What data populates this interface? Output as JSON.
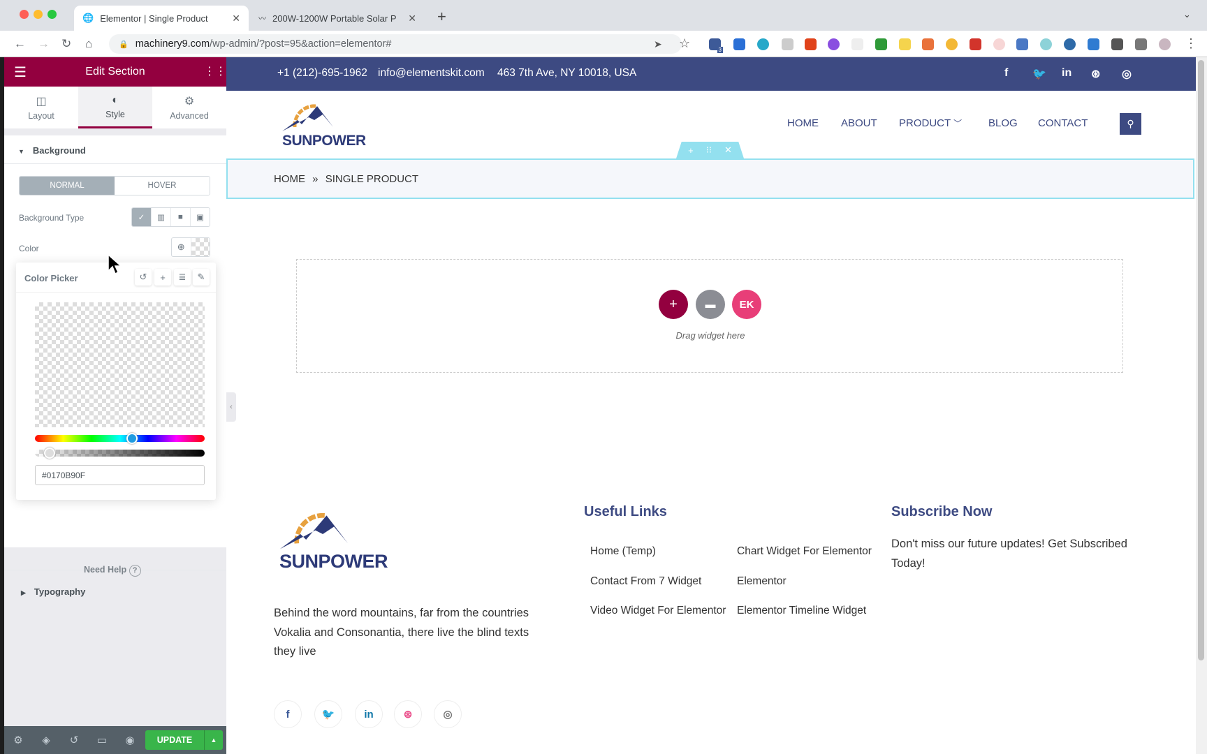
{
  "browser": {
    "tabs": [
      {
        "title": "Elementor | Single Product",
        "active": true
      },
      {
        "title": "200W-1200W Portable Solar P",
        "active": false
      }
    ],
    "url_host": "machinery9.com",
    "url_path": "/wp-admin/?post=95&action=elementor#",
    "extension_badge": "3"
  },
  "panel": {
    "title": "Edit Section",
    "tabs": [
      {
        "label": "Layout",
        "icon": "layout-icon"
      },
      {
        "label": "Style",
        "icon": "half-circle-icon",
        "active": true
      },
      {
        "label": "Advanced",
        "icon": "gear-icon"
      }
    ],
    "background_heading": "Background",
    "state_normal": "NORMAL",
    "state_hover": "HOVER",
    "background_type_label": "Background Type",
    "color_label": "Color",
    "color_picker": {
      "title": "Color Picker",
      "hex_value": "#0170B90F",
      "hue_fraction": 0.57,
      "alpha_fraction": 0.06
    },
    "typography_heading": "Typography",
    "need_help": "Need Help",
    "update_label": "UPDATE",
    "accent": "#93003f",
    "update_color": "#39b54a"
  },
  "site": {
    "topbar": {
      "phone": "+1 (212)-695-1962",
      "email": "info@elementskit.com",
      "address": "463 7th Ave, NY 10018, USA",
      "color": "#3d4a82"
    },
    "logo_text": "SUNPOWER",
    "nav": [
      "HOME",
      "ABOUT",
      "PRODUCT",
      "BLOG",
      "CONTACT"
    ],
    "breadcrumb": {
      "home": "HOME",
      "current": "SINGLE PRODUCT"
    },
    "drop_zone": "Drag widget here",
    "footer": {
      "about": "Behind the word mountains, far from the countries Vokalia and Consonantia, there live the blind texts they live",
      "useful_links_heading": "Useful Links",
      "links_col1": [
        "Home (Temp)",
        "Contact From 7 Widget",
        "Video Widget For Elementor"
      ],
      "links_col2": [
        "Chart Widget For Elementor",
        "Elementor",
        "Elementor Timeline Widget"
      ],
      "subscribe_heading": "Subscribe Now",
      "subscribe_text": "Don't miss our future updates! Get Subscribed Today!"
    }
  }
}
